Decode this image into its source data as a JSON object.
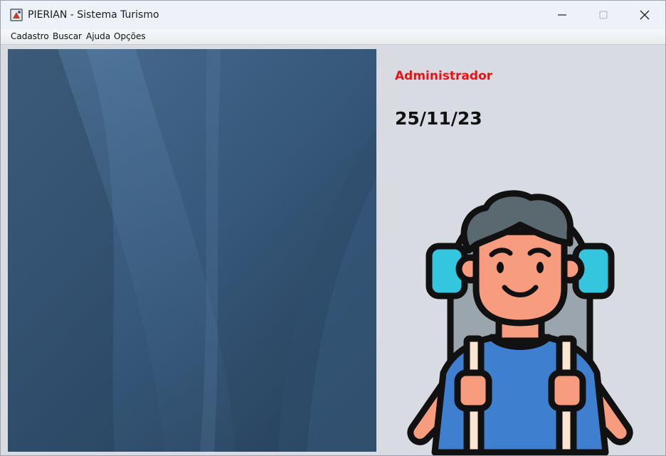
{
  "window": {
    "title": "PIERIAN - Sistema Turismo"
  },
  "menu": {
    "items": [
      "Cadastro",
      "Buscar",
      "Ajuda",
      "Opções"
    ]
  },
  "main": {
    "user_role": "Administrador",
    "date": "25/11/23"
  },
  "colors": {
    "title_bar": "#eef2f8",
    "content_bg": "#d8dbe2",
    "user_role": "#ee1111",
    "panel_dark": "#2a4560",
    "panel_light": "#4b7296"
  },
  "icons": {
    "app": "app-icon",
    "minimize": "minimize-icon",
    "maximize": "maximize-icon",
    "close": "close-icon",
    "illustration": "backpacker-illustration"
  }
}
